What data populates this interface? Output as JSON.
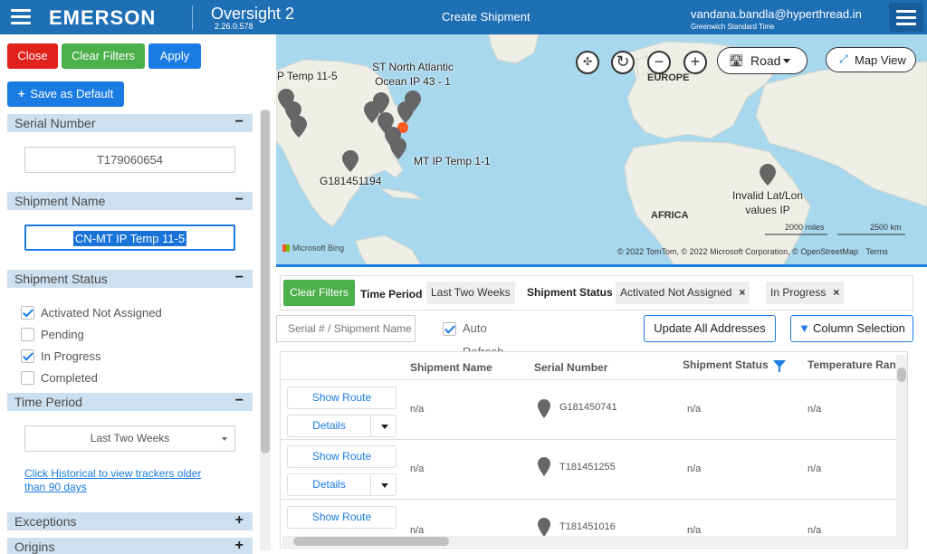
{
  "header": {
    "brand": "EMERSON",
    "product": "Oversight 2",
    "version": "2.26.0.578",
    "page_title": "Create Shipment",
    "user_email": "vandana.bandla@hyperthread.in",
    "timezone": "Greenwich Standard Time"
  },
  "sidebar": {
    "close_label": "Close",
    "clear_filters_label": "Clear Filters",
    "apply_label": "Apply",
    "save_default_label": "Save as Default",
    "serial_number": {
      "label": "Serial Number",
      "sign": "−",
      "value": "T179060654"
    },
    "shipment_name": {
      "label": "Shipment Name",
      "sign": "−",
      "value": "CN-MT IP Temp 11-5"
    },
    "shipment_status": {
      "label": "Shipment Status",
      "sign": "−",
      "options": [
        {
          "label": "Activated Not Assigned",
          "checked": true
        },
        {
          "label": "Pending",
          "checked": false
        },
        {
          "label": "In Progress",
          "checked": true
        },
        {
          "label": "Completed",
          "checked": false
        }
      ]
    },
    "time_period": {
      "label": "Time Period",
      "sign": "−",
      "selected": "Last Two Weeks"
    },
    "historical_link": "Click Historical to view trackers older than 90 days",
    "exceptions": {
      "label": "Exceptions",
      "sign": "+"
    },
    "origins": {
      "label": "Origins",
      "sign": "+"
    }
  },
  "map": {
    "labels": {
      "p_temp": "P Temp 11-5",
      "st_north": "ST North Atlantic Ocean IP 43 - 1",
      "mt_ip": "MT IP Temp 1-1",
      "g181": "G181451194",
      "invalid": "Invalid Lat/Lon values IP"
    },
    "regions": {
      "europe": "EUROPE",
      "africa": "AFRICA"
    },
    "road_label": "Road",
    "map_view_label": "Map View",
    "scale_miles": "2000 miles",
    "scale_km": "2500 km",
    "attribution": "© 2022 TomTom, © 2022 Microsoft Corporation, © OpenStreetMap",
    "terms": "Terms",
    "bing": "Microsoft Bing",
    "icons": [
      "cluster-icon",
      "refresh-icon",
      "zoom-out-icon",
      "zoom-in-icon"
    ]
  },
  "filterbar": {
    "clear_label": "Clear Filters",
    "time_period_label": "Time Period",
    "time_period_value": "Last Two Weeks",
    "shipment_status_label": "Shipment Status",
    "chips": [
      "Activated Not Assigned",
      "In Progress"
    ]
  },
  "toolbar": {
    "search_placeholder": "Serial # / Shipment Name",
    "auto_refresh_label": "Auto Refresh",
    "update_all_label": "Update All Addresses",
    "column_selection_label": "Column Selection"
  },
  "grid": {
    "columns": [
      "Shipment Name",
      "Serial Number",
      "Shipment Status",
      "Temperature Range"
    ],
    "show_route_label": "Show Route",
    "details_label": "Details",
    "rows": [
      {
        "shipment_name": "n/a",
        "serial": "G181450741",
        "status": "n/a",
        "temperature": "n/a"
      },
      {
        "shipment_name": "n/a",
        "serial": "T181451255",
        "status": "n/a",
        "temperature": "n/a"
      },
      {
        "shipment_name": "n/a",
        "serial": "T181451016",
        "status": "n/a",
        "temperature": "n/a"
      }
    ]
  },
  "colors": {
    "header": "#1f6fb5",
    "accent": "#1a7be3",
    "close": "#e0221c",
    "green": "#4cb04a",
    "water": "#a8d8ee",
    "land": "#eef0e8"
  }
}
